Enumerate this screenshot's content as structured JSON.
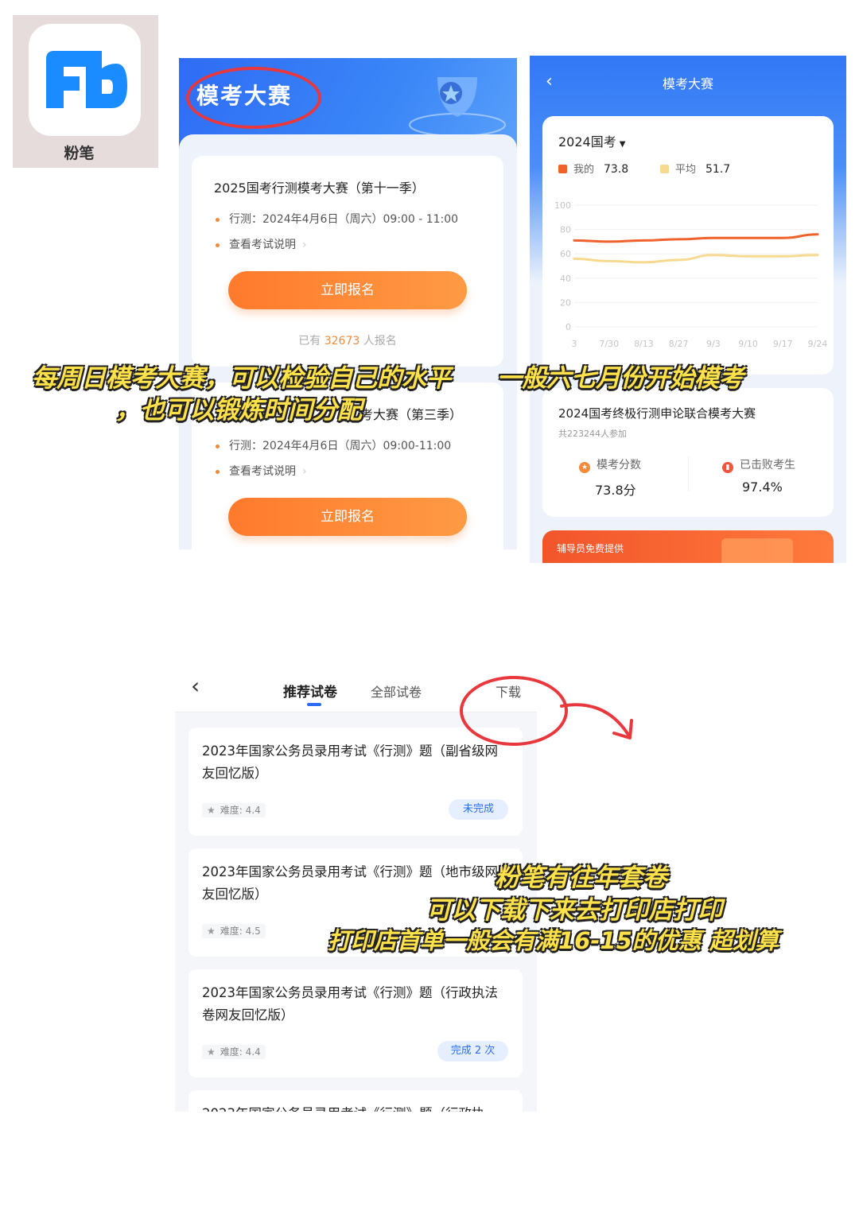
{
  "app": {
    "name": "粉笔",
    "logo_text": "Fb",
    "brand_color": "#1a8cff"
  },
  "left_panel": {
    "header_title": "模考大赛",
    "contests": [
      {
        "title": "2025国考行测模考大赛（第十一季）",
        "time": "行测：2024年4月6日（周六）09:00 - 11:00",
        "info_link": "查看考试说明",
        "cta": "立即报名",
        "enrolled_prefix": "已有",
        "enrolled_count": "32673",
        "enrolled_suffix": "人报名"
      },
      {
        "title": "考大赛（第三季）",
        "time": "行测：2024年4月6日（周六）09:00-11:00",
        "info_link": "查看考试说明",
        "cta": "立即报名"
      }
    ]
  },
  "right_panel": {
    "nav_title": "模考大赛",
    "chart_card": {
      "exam": "2024国考",
      "legend_mine_label": "我的",
      "legend_mine_value": "73.8",
      "legend_avg_label": "平均",
      "legend_avg_value": "51.7"
    },
    "result_card": {
      "title": "2024国考终极行测申论联合模考大赛",
      "participants": "共223244人参加",
      "score_label": "模考分数",
      "score_value": "73.8分",
      "beat_label": "已击败考生",
      "beat_value": "97.4%"
    },
    "banner": {
      "text": "辅导员免费提供"
    }
  },
  "chart_data": {
    "type": "line",
    "x": [
      "3",
      "7/30",
      "8/13",
      "8/27",
      "9/3",
      "9/10",
      "9/17",
      "9/24"
    ],
    "yticks": [
      "100",
      "80",
      "60",
      "40",
      "20",
      "0"
    ],
    "ylim": [
      0,
      100
    ],
    "series": [
      {
        "name": "我的",
        "color": "#f0622b",
        "values": [
          71,
          70,
          71,
          72,
          73,
          73,
          73,
          76
        ]
      },
      {
        "name": "平均",
        "color": "#f7da8f",
        "values": [
          56,
          54,
          53,
          55,
          59,
          58,
          58,
          59
        ]
      }
    ]
  },
  "captions": {
    "c1_line1": "每周日模考大赛，可以检验自己的水平",
    "c1_line2": "，也可以锻炼时间分配",
    "c2": "一般六七月份开始模考",
    "c3_line1": "粉笔有往年套卷",
    "c3_line2": "可以下载下来去打印店打印",
    "c3_line3": "打印店首单一般会有满16-15的优惠 超划算"
  },
  "bottom_panel": {
    "tabs": [
      "推荐试卷",
      "全部试卷"
    ],
    "download": "下载",
    "papers": [
      {
        "title": "2023年国家公务员录用考试《行测》题（副省级网友回忆版）",
        "difficulty": "难度: 4.4",
        "status": "未完成"
      },
      {
        "title": "2023年国家公务员录用考试《行测》题（地市级网友回忆版）",
        "difficulty": "难度: 4.5",
        "status": ""
      },
      {
        "title": "2023年国家公务员录用考试《行测》题（行政执法卷网友回忆版）",
        "difficulty": "难度: 4.4",
        "status": "完成 2 次"
      },
      {
        "title": "2023年国家公务员录用考试《行测》题（行政执",
        "difficulty": "",
        "status": ""
      }
    ]
  }
}
